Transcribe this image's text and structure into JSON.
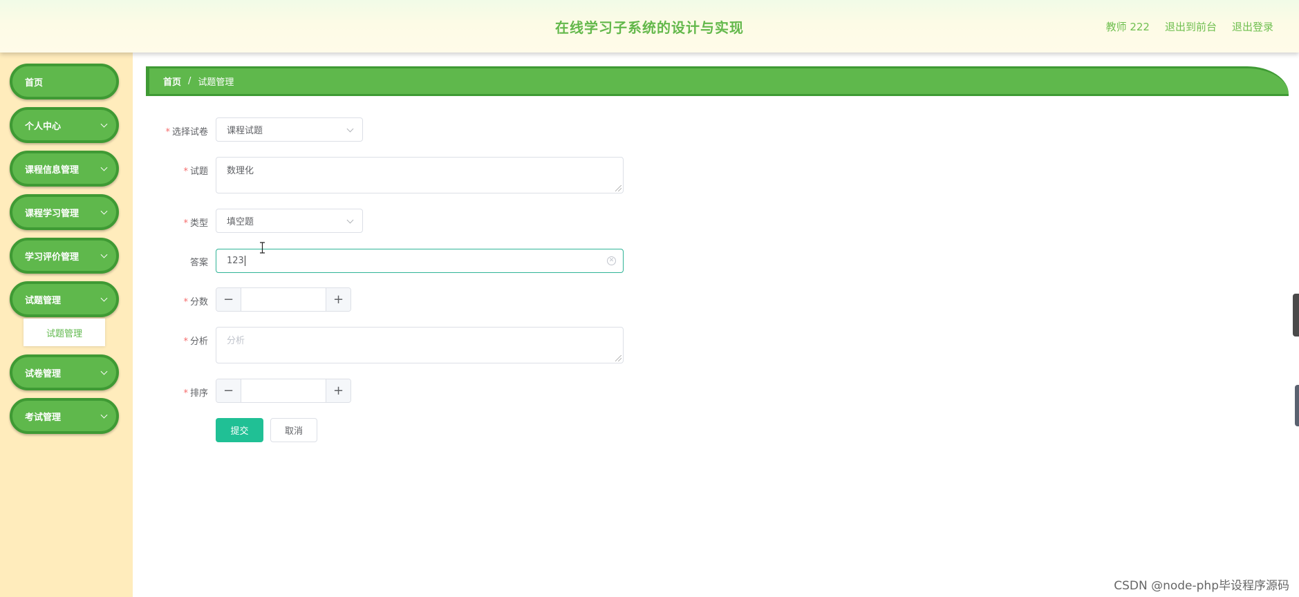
{
  "header": {
    "title": "在线学习子系统的设计与实现",
    "nav": {
      "user": "教师 222",
      "front": "退出到前台",
      "logout": "退出登录"
    }
  },
  "sidebar": {
    "items": [
      {
        "label": "首页"
      },
      {
        "label": "个人中心"
      },
      {
        "label": "课程信息管理"
      },
      {
        "label": "课程学习管理"
      },
      {
        "label": "学习评价管理"
      },
      {
        "label": "试题管理"
      },
      {
        "label": "试卷管理"
      },
      {
        "label": "考试管理"
      }
    ],
    "submenu": {
      "label": "试题管理"
    }
  },
  "breadcrumb": {
    "home": "首页",
    "separator": "/",
    "current": "试题管理"
  },
  "form": {
    "required_mark": "*",
    "paper": {
      "label": "选择试卷",
      "value": "课程试题"
    },
    "question": {
      "label": "试题",
      "value": "数理化"
    },
    "type": {
      "label": "类型",
      "value": "填空题"
    },
    "answer": {
      "label": "答案",
      "value": "123"
    },
    "score": {
      "label": "分数",
      "value": ""
    },
    "analysis": {
      "label": "分析",
      "placeholder": "分析"
    },
    "order": {
      "label": "排序",
      "value": ""
    },
    "stepper_minus": "−",
    "stepper_plus": "+",
    "submit": "提交",
    "cancel": "取消"
  },
  "watermark": "CSDN @node-php毕设程序源码",
  "colors": {
    "brand_green": "#5fb84c",
    "brand_green_dark": "#3f9a34",
    "sidebar_bg": "#ffecbc",
    "primary_button": "#20c095",
    "focus_border": "#2eb396",
    "required": "#f56c6c"
  },
  "icons": {
    "select_arrow": "chevron-down-icon",
    "menu_arrow": "chevron-down-icon",
    "clear": "close-circle-icon"
  }
}
